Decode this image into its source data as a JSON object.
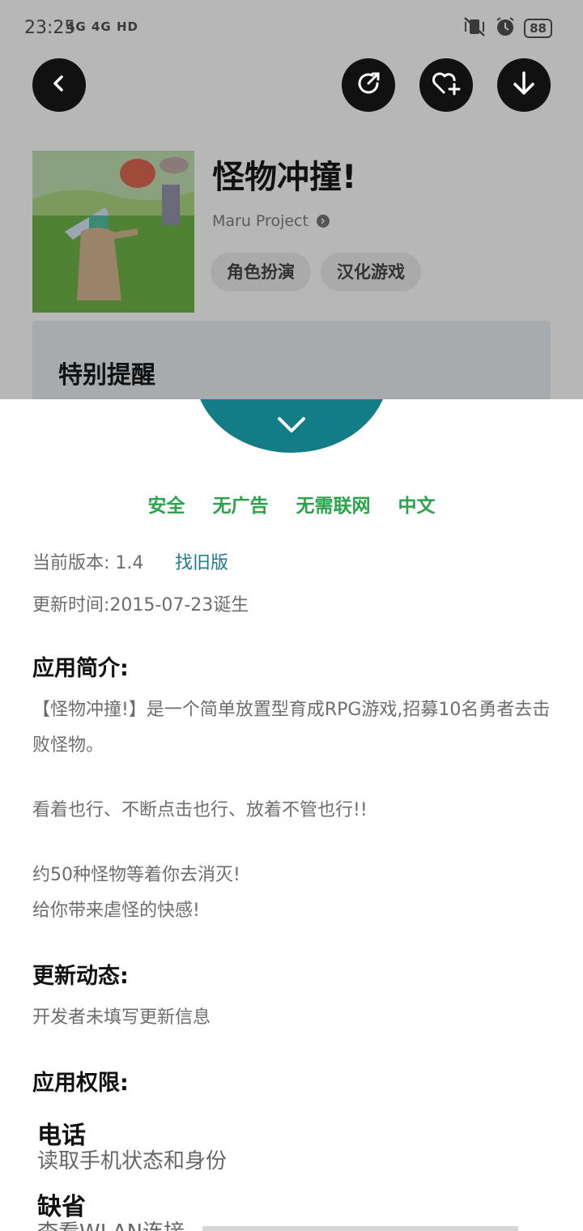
{
  "status_bar": {
    "time": "23:25",
    "signal": "4G 4G HD",
    "battery": "88"
  },
  "app": {
    "title": "怪物冲撞!",
    "developer": "Maru Project",
    "tags": [
      "角色扮演",
      "汉化游戏"
    ],
    "notice_title": "特别提醒"
  },
  "sheet": {
    "badges": [
      "安全",
      "无广告",
      "无需联网",
      "中文"
    ],
    "version_label": "当前版本: 1.4",
    "old_version_link": "找旧版",
    "update_time": "更新时间:2015-07-23诞生",
    "intro_heading": "应用简介:",
    "intro_paragraphs": [
      "【怪物冲撞!】是一个简单放置型育成RPG游戏,招募10名勇者去击败怪物。",
      "看着也行、不断点击也行、放着不管也行!!",
      "约50种怪物等着你去消灭!\n给你带来虐怪的快感!"
    ],
    "update_heading": "更新动态:",
    "update_text": "开发者未填写更新信息",
    "permissions_heading": "应用权限:",
    "permissions": [
      {
        "title": "电话",
        "desc": "读取手机状态和身份"
      },
      {
        "title": "缺省",
        "desc": "查看WLAN连接"
      }
    ]
  },
  "colors": {
    "accent": "#137d87",
    "badge_green": "#2aa34a",
    "link": "#1e7c8a"
  }
}
